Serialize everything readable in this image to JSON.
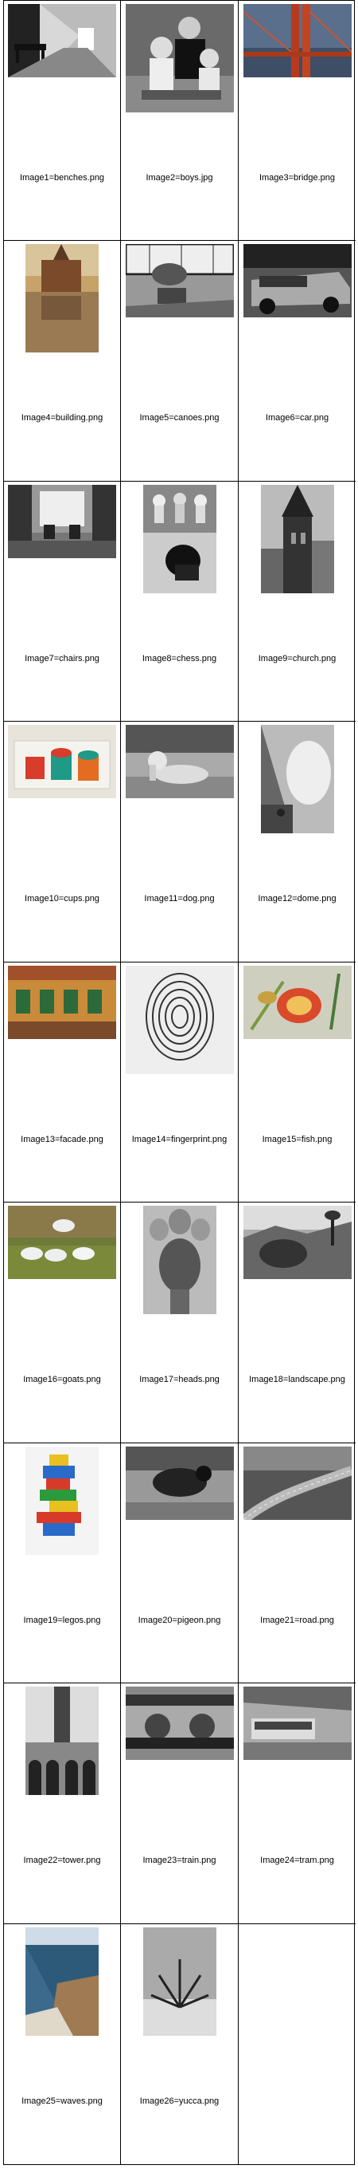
{
  "images": [
    {
      "caption": "Image1=benches.png",
      "icon": "corridor-benches-photo",
      "tone": "gray"
    },
    {
      "caption": "Image2=boys.jpg",
      "icon": "boys-portrait-photo",
      "tone": "gray"
    },
    {
      "caption": "Image3=bridge.png",
      "icon": "bridge-photo",
      "tone": "color"
    },
    {
      "caption": "Image4=building.png",
      "icon": "building-reflection-photo",
      "tone": "color"
    },
    {
      "caption": "Image5=canoes.png",
      "icon": "canoes-photo",
      "tone": "gray"
    },
    {
      "caption": "Image6=car.png",
      "icon": "car-photo",
      "tone": "gray"
    },
    {
      "caption": "Image7=chairs.png",
      "icon": "chairs-room-photo",
      "tone": "gray"
    },
    {
      "caption": "Image8=chess.png",
      "icon": "chess-pieces-photo",
      "tone": "gray"
    },
    {
      "caption": "Image9=church.png",
      "icon": "church-tower-photo",
      "tone": "gray"
    },
    {
      "caption": "Image10=cups.png",
      "icon": "cups-photo",
      "tone": "color"
    },
    {
      "caption": "Image11=dog.png",
      "icon": "dog-photo",
      "tone": "gray"
    },
    {
      "caption": "Image12=dome.png",
      "icon": "dome-photo",
      "tone": "gray"
    },
    {
      "caption": "Image13=facade.png",
      "icon": "facade-photo",
      "tone": "color"
    },
    {
      "caption": "Image14=fingerprint.png",
      "icon": "fingerprint-photo",
      "tone": "gray"
    },
    {
      "caption": "Image15=fish.png",
      "icon": "fish-photo",
      "tone": "color"
    },
    {
      "caption": "Image16=goats.png",
      "icon": "goats-photo",
      "tone": "color"
    },
    {
      "caption": "Image17=heads.png",
      "icon": "heads-sculpture-photo",
      "tone": "gray"
    },
    {
      "caption": "Image18=landscape.png",
      "icon": "landscape-photo",
      "tone": "gray"
    },
    {
      "caption": "Image19=legos.png",
      "icon": "legos-photo",
      "tone": "color"
    },
    {
      "caption": "Image20=pigeon.png",
      "icon": "pigeon-photo",
      "tone": "gray"
    },
    {
      "caption": "Image21=road.png",
      "icon": "road-photo",
      "tone": "gray"
    },
    {
      "caption": "Image22=tower.png",
      "icon": "tower-arches-photo",
      "tone": "gray"
    },
    {
      "caption": "Image23=train.png",
      "icon": "train-photo",
      "tone": "gray"
    },
    {
      "caption": "Image24=tram.png",
      "icon": "tram-photo",
      "tone": "gray"
    },
    {
      "caption": "Image25=waves.png",
      "icon": "waves-coast-photo",
      "tone": "color"
    },
    {
      "caption": "Image26=yucca.png",
      "icon": "yucca-photo",
      "tone": "gray"
    }
  ]
}
